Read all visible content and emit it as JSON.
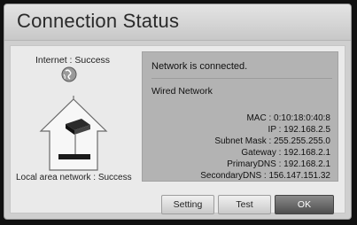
{
  "dialog": {
    "title": "Connection Status",
    "internet_label": "Internet : Success",
    "lan_label": "Local area network : Success",
    "status_message": "Network is connected.",
    "connection_type": "Wired Network",
    "details": [
      {
        "label": "MAC",
        "value": "0:10:18:0:40:8"
      },
      {
        "label": "IP",
        "value": "192.168.2.5"
      },
      {
        "label": "Subnet Mask",
        "value": "255.255.255.0"
      },
      {
        "label": "Gateway",
        "value": "192.168.2.1"
      },
      {
        "label": "PrimaryDNS",
        "value": "192.168.2.1"
      },
      {
        "label": "SecondaryDNS",
        "value": "156.147.151.32"
      }
    ],
    "buttons": {
      "setting": "Setting",
      "test": "Test",
      "ok": "OK"
    }
  },
  "icons": [
    "globe-icon",
    "house-icon",
    "router-icon",
    "player-device-icon"
  ]
}
